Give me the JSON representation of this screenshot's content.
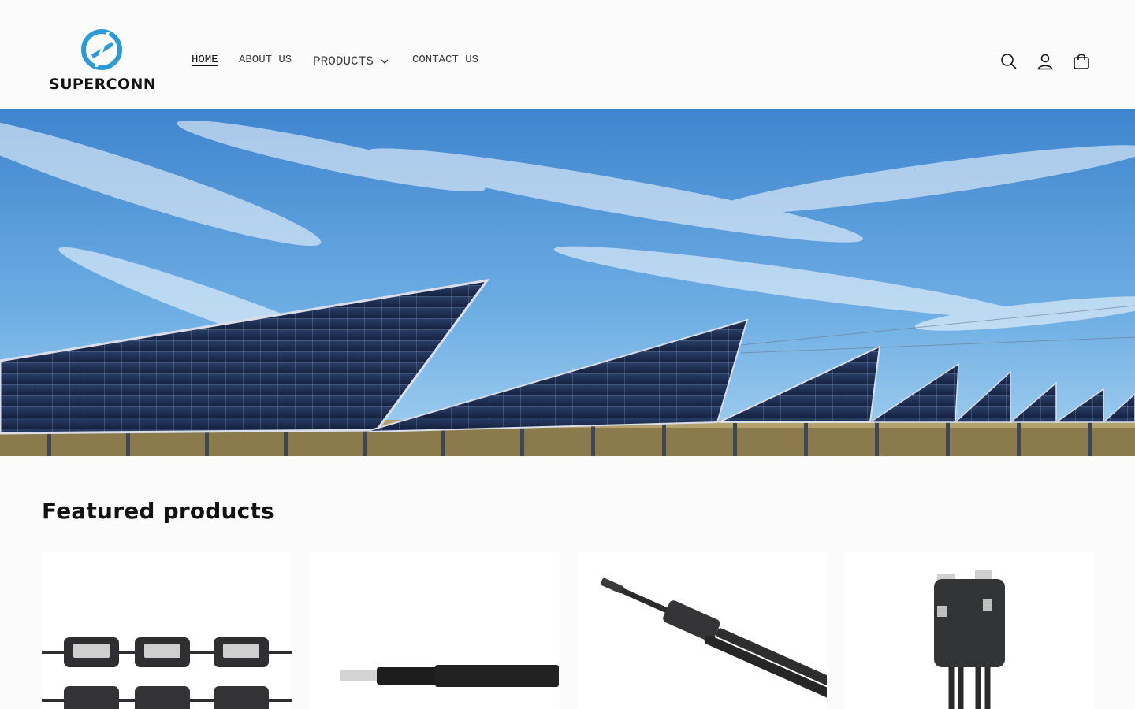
{
  "brand": {
    "name": "SUPERCONN",
    "accent": "#2b9ad8",
    "text_color": "#111111"
  },
  "nav": {
    "items": [
      {
        "label": "HOME",
        "active": true
      },
      {
        "label": "ABOUT US",
        "active": false
      },
      {
        "label": "PRODUCTS",
        "active": false,
        "has_dropdown": true
      },
      {
        "label": "CONTACT US",
        "active": false
      }
    ]
  },
  "header_icons": [
    "search-icon",
    "account-icon",
    "cart-icon"
  ],
  "hero": {
    "image_subject": "solar panel arrays under blue sky",
    "sky_color": "#5b9fd8",
    "panel_color": "#1c2b4a"
  },
  "featured": {
    "title": "Featured products",
    "products": [
      {
        "image": "junction-box-grid"
      },
      {
        "image": "solar-cable"
      },
      {
        "image": "branch-connector"
      },
      {
        "image": "split-junction-box"
      }
    ]
  }
}
